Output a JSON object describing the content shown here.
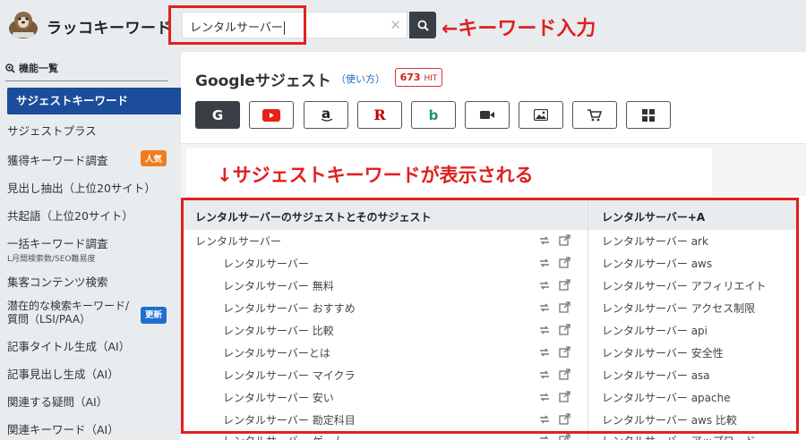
{
  "header": {
    "logo_text": "ラッコキーワード",
    "search_value": "レンタルサーバー",
    "annotation": "←キーワード入力"
  },
  "sidebar": {
    "heading": "機能一覧",
    "items": [
      {
        "label": "サジェストキーワード",
        "active": true
      },
      {
        "label": "サジェストプラス"
      },
      {
        "label": "獲得キーワード調査",
        "badge": "人気"
      },
      {
        "label": "見出し抽出（上位20サイト）"
      },
      {
        "label": "共起語（上位20サイト）"
      },
      {
        "label": "一括キーワード調査",
        "sub": "L月間検索数/SEO難易度"
      },
      {
        "label": "集客コンテンツ検索"
      },
      {
        "label": "潜在的な検索キーワード/",
        "label2": "質問（LSI/PAA）",
        "badge": "更新"
      },
      {
        "label": "記事タイトル生成（AI）"
      },
      {
        "label": "記事見出し生成（AI）"
      },
      {
        "label": "関連する疑問（AI）"
      },
      {
        "label": "関連キーワード（AI）"
      }
    ]
  },
  "main": {
    "title": "Googleサジェスト",
    "usage_link": "（使い方）",
    "hit_count": "673",
    "hit_unit": "HIT",
    "annotation": "↓サジェストキーワードが表示される",
    "engines": [
      {
        "name": "google-icon",
        "label": "G"
      },
      {
        "name": "youtube-icon"
      },
      {
        "name": "amazon-icon",
        "label": "a"
      },
      {
        "name": "rakuten-icon",
        "label": "R"
      },
      {
        "name": "bing-icon",
        "label": "b"
      },
      {
        "name": "video-icon"
      },
      {
        "name": "image-icon"
      },
      {
        "name": "shopping-cart-icon"
      },
      {
        "name": "grid-icon"
      }
    ]
  },
  "table": {
    "left_header": "レンタルサーバーのサジェストとそのサジェスト",
    "right_header": "レンタルサーバー+A",
    "left_rows": [
      "レンタルサーバー",
      "レンタルサーバー",
      "レンタルサーバー 無料",
      "レンタルサーバー おすすめ",
      "レンタルサーバー 比較",
      "レンタルサーバーとは",
      "レンタルサーバー マイクラ",
      "レンタルサーバー 安い",
      "レンタルサーバー 勘定科目",
      "レンタルサーバー ゲーム"
    ],
    "right_rows": [
      "レンタルサーバー ark",
      "レンタルサーバー aws",
      "レンタルサーバー アフィリエイト",
      "レンタルサーバー アクセス制限",
      "レンタルサーバー api",
      "レンタルサーバー 安全性",
      "レンタルサーバー asa",
      "レンタルサーバー apache",
      "レンタルサーバー aws 比較",
      "レンタルサーバー アップロード"
    ]
  },
  "colors": {
    "accent_blue": "#1b4d9b",
    "annotation_red": "#e02020",
    "badge_orange": "#f07c1e",
    "badge_blue": "#1f6fd1"
  }
}
